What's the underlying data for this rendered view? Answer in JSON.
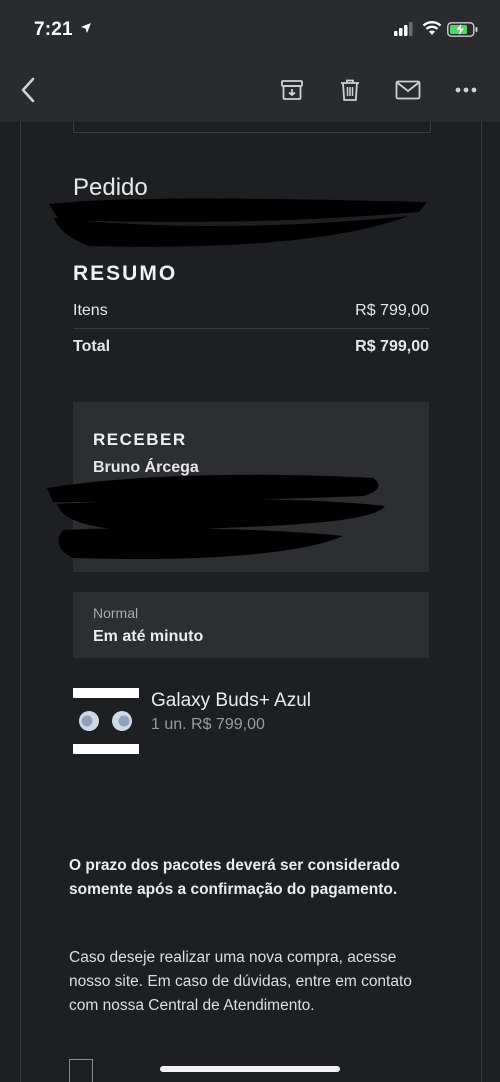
{
  "status_bar": {
    "time": "7:21"
  },
  "toolbar": {
    "icons": [
      "back-chevron-icon",
      "archive-icon",
      "trash-icon",
      "mail-icon",
      "more-icon"
    ]
  },
  "order": {
    "heading": "Pedido"
  },
  "summary": {
    "title": "RESUMO",
    "items_label": "Itens",
    "items_value": "R$ 799,00",
    "total_label": "Total",
    "total_value": "R$ 799,00"
  },
  "receive": {
    "title": "RECEBER",
    "name": "Bruno Árcega"
  },
  "shipping": {
    "label": "Normal",
    "value": "Em até minuto"
  },
  "product": {
    "name": "Galaxy Buds+ Azul",
    "qty_price": "1 un. R$ 799,00"
  },
  "notice": {
    "text": "O prazo dos pacotes deverá ser considerado somente após a confirmação do pagamento."
  },
  "info": {
    "text": "Caso deseje realizar uma nova compra, acesse nosso site. Em caso de dúvidas, entre em contato com nossa Central de Atendimento."
  },
  "colors": {
    "background": "#1e1f22",
    "panel": "#2d2e31",
    "bar": "#2a2b2e",
    "battery_green": "#4cd964"
  }
}
